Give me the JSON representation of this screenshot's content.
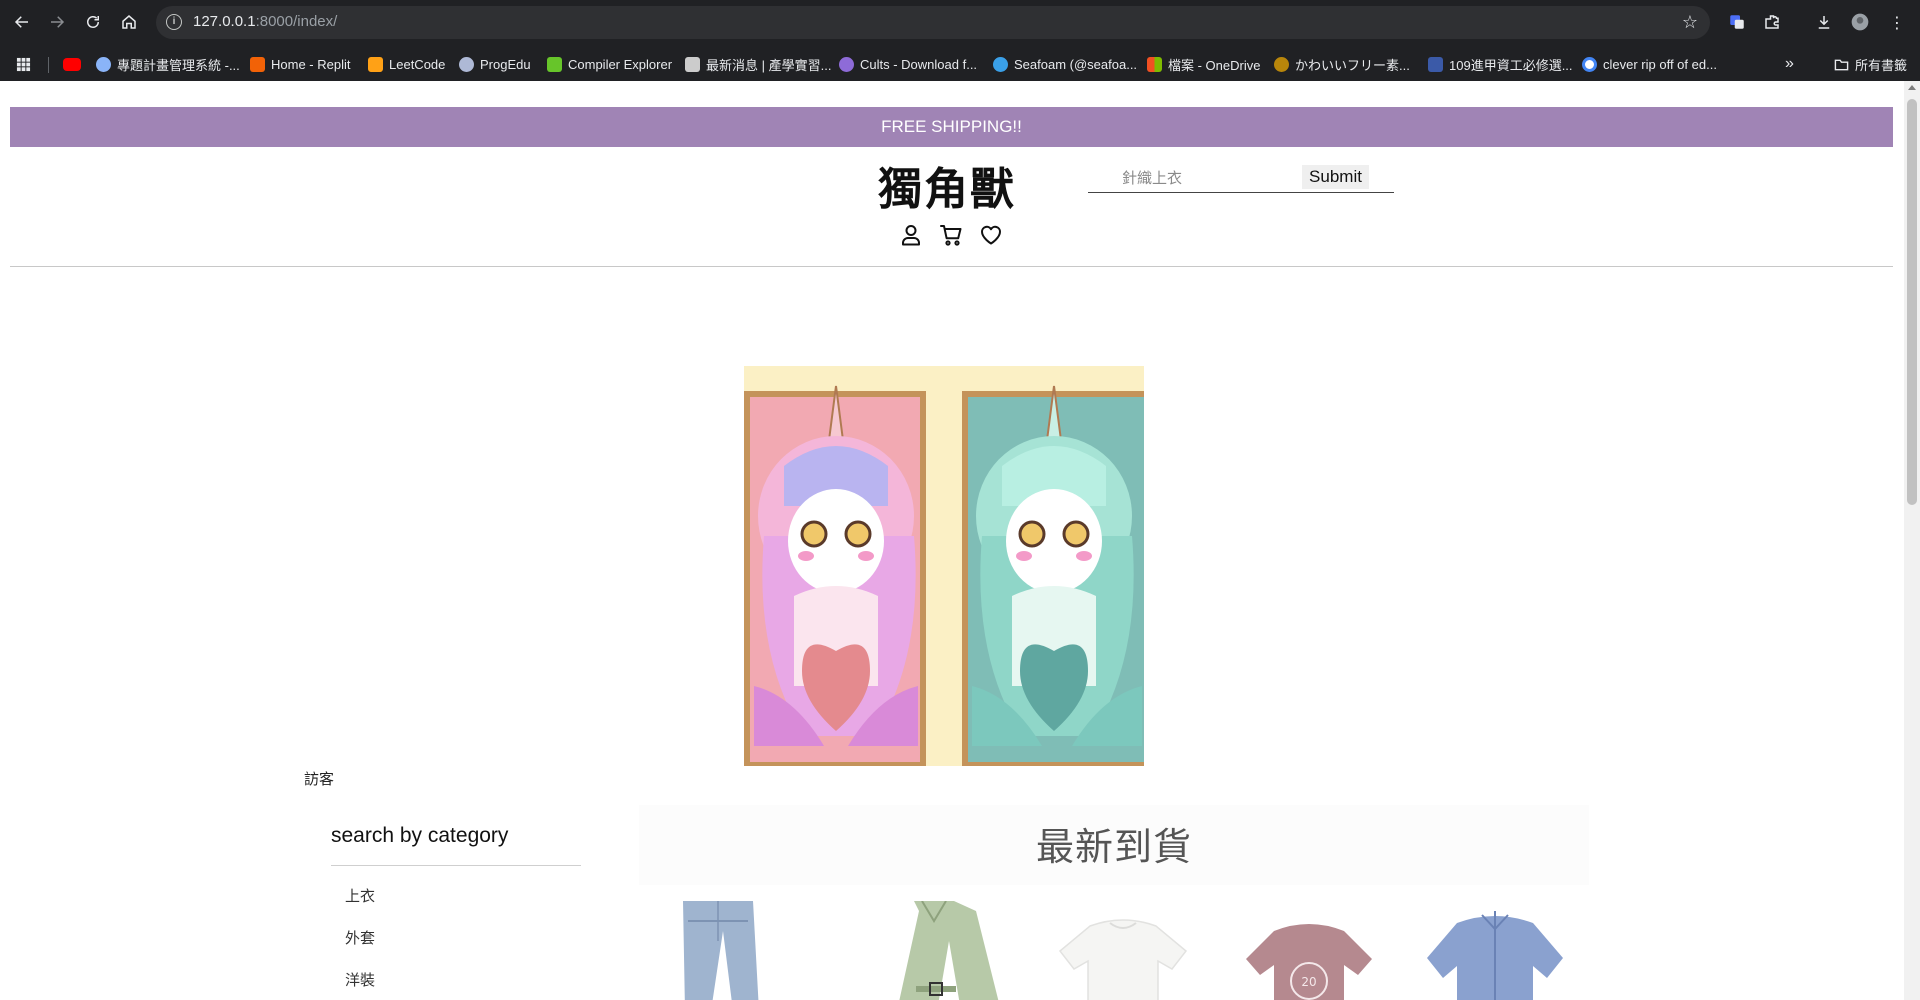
{
  "browser": {
    "url_host": "127.0.0.1",
    "url_rest": ":8000/index/",
    "bookmarks": [
      {
        "label": "",
        "color": "#ff0000"
      },
      {
        "label": "專題計畫管理系統 -...",
        "color": "#8ab4f8"
      },
      {
        "label": "Home - Replit",
        "color": "#f26207"
      },
      {
        "label": "LeetCode",
        "color": "#ffa116"
      },
      {
        "label": "ProgEdu",
        "color": "#aeb9d6"
      },
      {
        "label": "Compiler Explorer",
        "color": "#67c52a"
      },
      {
        "label": "最新消息 | 產學實習...",
        "color": "#cccccc"
      },
      {
        "label": "Cults - Download f...",
        "color": "#8e6bd8"
      },
      {
        "label": "Seafoam (@seafoa...",
        "color": "#3aa0e8"
      },
      {
        "label": "檔案 - OneDrive",
        "color": "#f25022"
      },
      {
        "label": "かわいいフリー素...",
        "color": "#b8860b"
      },
      {
        "label": "109進甲資工必修選...",
        "color": "#3b5aa8"
      },
      {
        "label": "clever rip off of ed...",
        "color": "#ffffff"
      }
    ],
    "all_bookmarks_label": "所有書籤"
  },
  "site": {
    "banner": "FREE SHIPPING!!",
    "logo": "獨角獸",
    "search": {
      "placeholder": "針織上衣",
      "submit": "Submit"
    },
    "header_icons": [
      "user-icon",
      "cart-icon",
      "heart-icon"
    ]
  },
  "user": {
    "status": "訪客"
  },
  "sidebar": {
    "title": "search by category",
    "items": [
      {
        "label": "上衣"
      },
      {
        "label": "外套"
      },
      {
        "label": "洋裝"
      }
    ]
  },
  "new_arrivals": {
    "title": "最新到貨",
    "products": [
      {
        "name": "jeans"
      },
      {
        "name": "trench-coat"
      },
      {
        "name": "white-tee"
      },
      {
        "name": "college-sweatshirt"
      },
      {
        "name": "striped-shirt"
      }
    ]
  },
  "colors": {
    "banner": "#a084b5",
    "chrome": "#202124"
  }
}
